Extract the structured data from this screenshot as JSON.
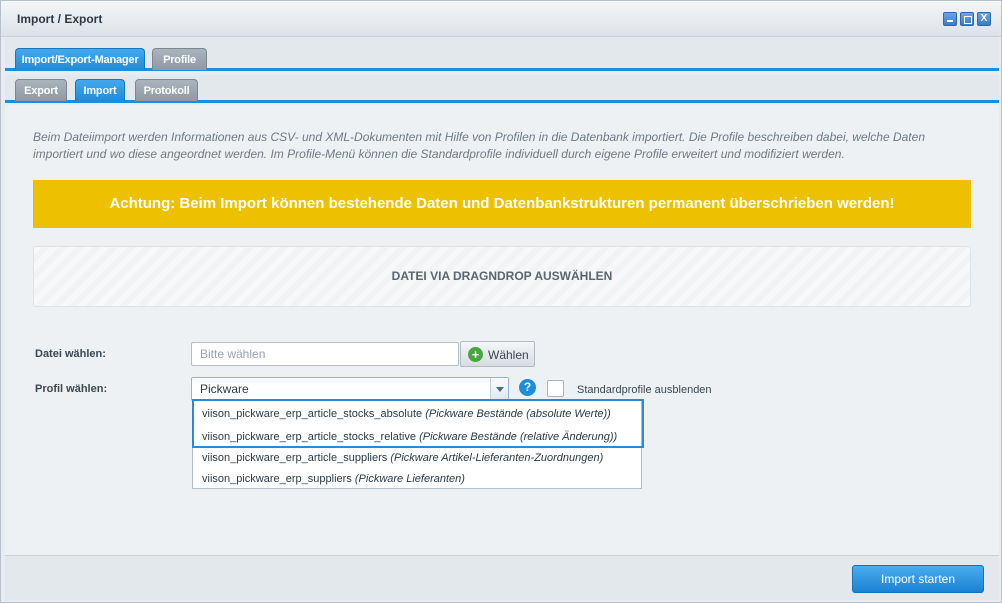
{
  "window": {
    "title": "Import / Export",
    "controls": [
      "minimize-icon",
      "maximize-icon",
      "close-icon"
    ],
    "close_glyph": "X"
  },
  "main_tabs": [
    {
      "label": "Import/Export-Manager",
      "active": true
    },
    {
      "label": "Profile",
      "active": false
    }
  ],
  "sub_tabs": [
    {
      "label": "Export",
      "active": false
    },
    {
      "label": "Import",
      "active": true
    },
    {
      "label": "Protokoll",
      "active": false
    }
  ],
  "import": {
    "intro": "Beim Dateiimport werden Informationen aus CSV- und XML-Dokumenten mit Hilfe von Profilen in die Datenbank importiert. Die Profile beschreiben dabei, welche Daten importiert und wo diese angeordnet werden. Im Profile-Menü können die Standardprofile individuell durch eigene Profile erweitert und modifiziert werden.",
    "warning": "Achtung: Beim Import können bestehende Daten und Datenbankstrukturen permanent überschrieben werden!",
    "dropzone": "DATEI VIA DRAGNDROP AUSWÄHLEN",
    "file_label": "Datei wählen:",
    "file_placeholder": "Bitte wählen",
    "choose_button": "Wählen",
    "profile_label": "Profil wählen:",
    "profile_value": "Pickware",
    "help_glyph": "?",
    "hide_default_label": "Standardprofile ausblenden",
    "hide_default_checked": false,
    "profile_options": [
      {
        "name": "viison_pickware_erp_article_stocks_absolute",
        "desc": "(Pickware Bestände (absolute Werte))"
      },
      {
        "name": "viison_pickware_erp_article_stocks_relative",
        "desc": "(Pickware Bestände (relative Änderung))"
      },
      {
        "name": "viison_pickware_erp_article_suppliers",
        "desc": "(Pickware Artikel-Lieferanten-Zuordnungen)"
      },
      {
        "name": "viison_pickware_erp_suppliers",
        "desc": "(Pickware Lieferanten)"
      }
    ]
  },
  "footer": {
    "start_button": "Import starten"
  },
  "colors": {
    "accent": "#1c8ddb",
    "warning": "#eec100",
    "success": "#4aa43f"
  }
}
